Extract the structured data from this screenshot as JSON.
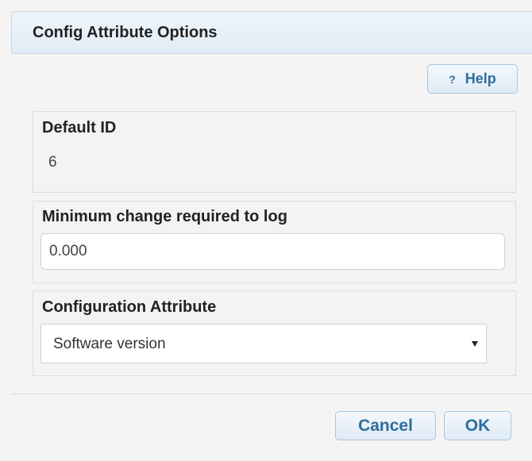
{
  "dialog": {
    "title": "Config Attribute Options"
  },
  "help": {
    "icon": "?",
    "label": "Help"
  },
  "default_id": {
    "label": "Default ID",
    "value": "6"
  },
  "minimum_change": {
    "label": "Minimum change required to log",
    "value": "0.000"
  },
  "config_attribute": {
    "label": "Configuration Attribute",
    "selected": "Software version"
  },
  "footer": {
    "cancel_label": "Cancel",
    "ok_label": "OK"
  },
  "colors": {
    "header_bg": "#e6eff7",
    "button_text": "#2e6e9e",
    "button_border": "#a9c6de",
    "panel_bg": "#f4f4f4"
  }
}
